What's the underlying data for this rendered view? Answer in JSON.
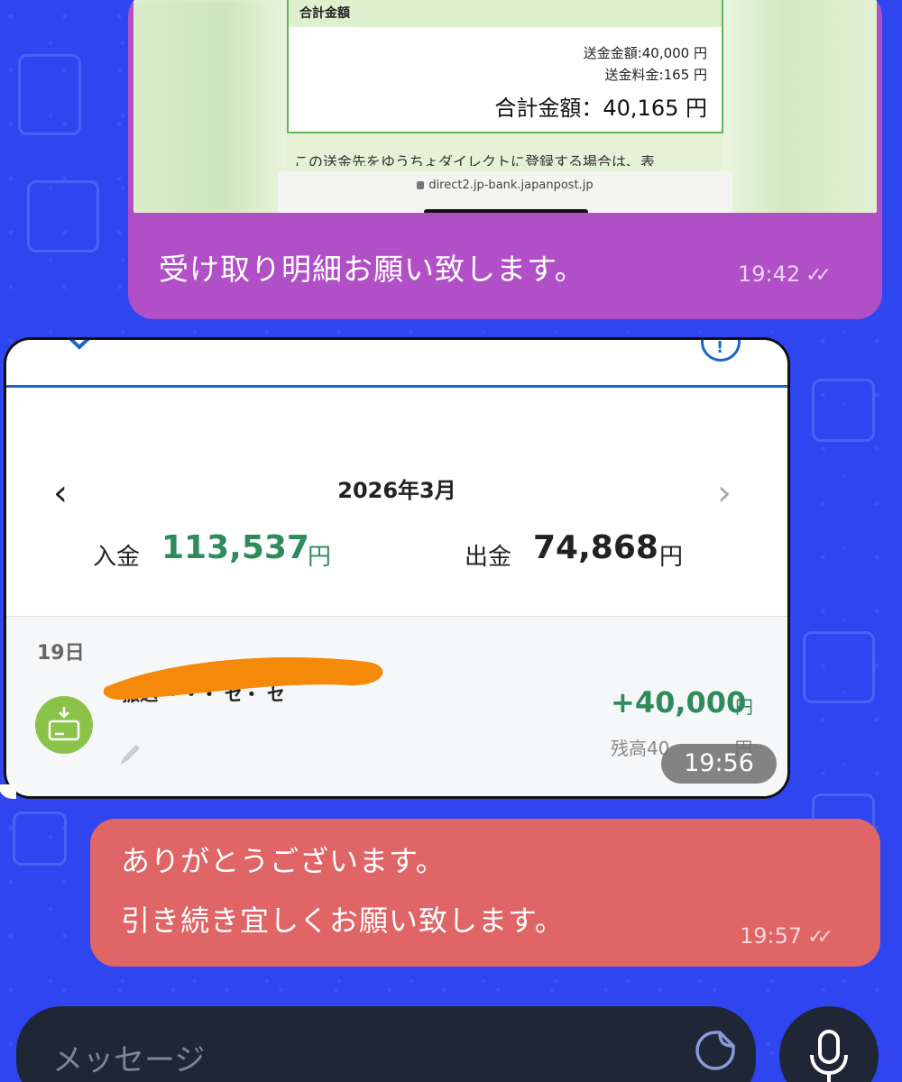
{
  "screenshot_1": {
    "section_title": "合計金額",
    "remit_amount": "送金金額:40,000 円",
    "fee": "送金料金:165 円",
    "total": "合計金額：40,165 円",
    "cut_text": "この送金先をゆうちょダイレクトに登録する場合は、表",
    "url": "direct2.jp-bank.japanpost.jp"
  },
  "message_1": {
    "text": "受け取り明細お願い致します。",
    "time": "19:42",
    "status_icon": "double-check-icon"
  },
  "bank_screenshot": {
    "month": "2026年3月",
    "income_label": "入金",
    "income_value": "113,537",
    "income_unit": "円",
    "expense_label": "出金",
    "expense_value": "74,868",
    "expense_unit": "円",
    "day": "19日",
    "tx_name_partial": "振込 ・・・ セ・ セ",
    "tx_amount": "+40,000",
    "tx_unit": "円",
    "tx_balance_partial": "残高40",
    "tx_balance_suffix": "円",
    "time": "19:56"
  },
  "message_2": {
    "line1": "ありがとうございます。",
    "line2": "引き続き宜しくお願い致します。",
    "time": "19:57",
    "status_icon": "double-check-icon"
  },
  "composer": {
    "placeholder": "メッセージ"
  },
  "colors": {
    "background": "#2e45f0",
    "bubble_purple": "#b14fc6",
    "bubble_red": "#e06566",
    "income_green": "#2e8b5c",
    "composer_dark": "#1f2636"
  }
}
